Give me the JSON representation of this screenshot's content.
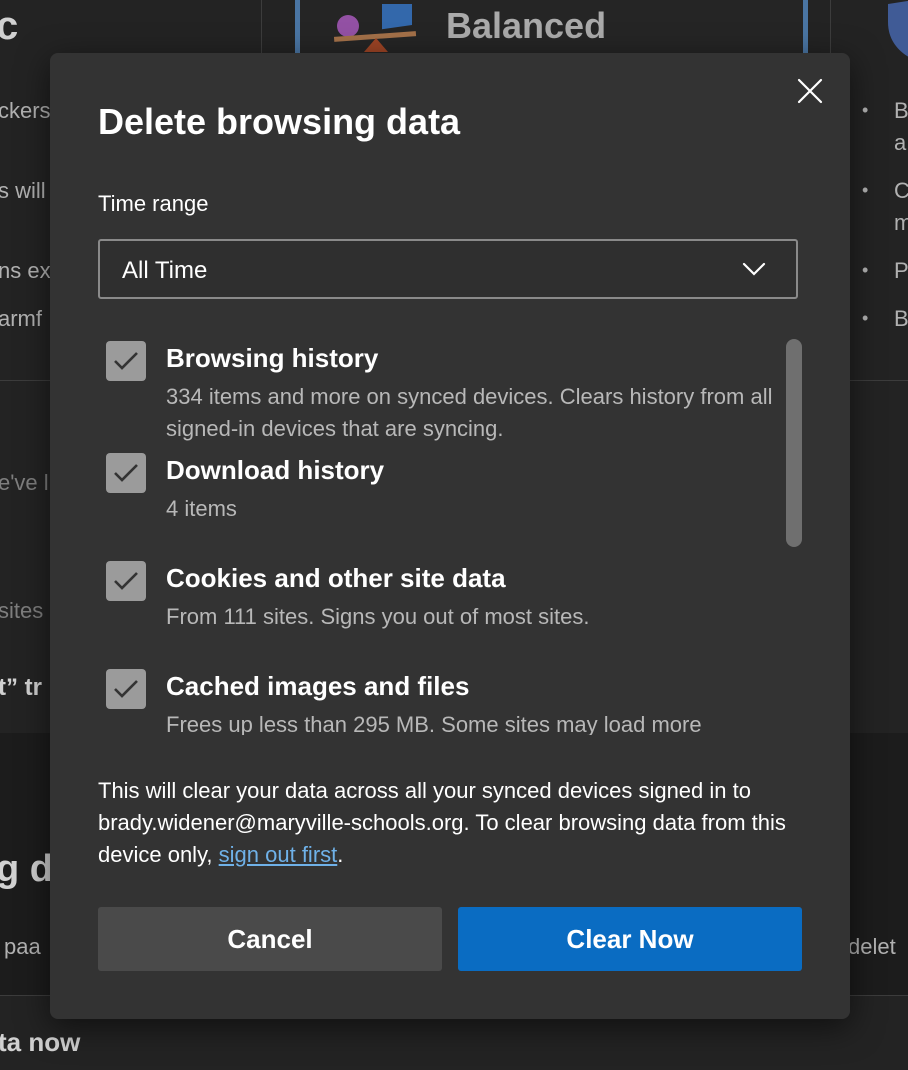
{
  "background": {
    "left_title_fragment": "c",
    "center_card_title": "Balanced",
    "left_text_fragments": [
      "ckers",
      "s will",
      "ns exp",
      "armf",
      "e've l",
      "sites",
      "t” tr"
    ],
    "right_bullets": [
      "B",
      "a",
      "C",
      "m",
      "P",
      "B"
    ],
    "section_heading_fragment": "g d",
    "bottom_left_fragment": "paa",
    "bottom_right_fragment": "delet",
    "footer_fragment": "ta now"
  },
  "dialog": {
    "title": "Delete browsing data",
    "close_icon": "close-icon",
    "time_range": {
      "label": "Time range",
      "selected": "All Time"
    },
    "items": [
      {
        "label": "Browsing history",
        "description": "334 items and more on synced devices. Clears history from all signed-in devices that are syncing.",
        "checked": true
      },
      {
        "label": "Download history",
        "description": "4 items",
        "checked": true
      },
      {
        "label": "Cookies and other site data",
        "description": "From 111 sites. Signs you out of most sites.",
        "checked": true
      },
      {
        "label": "Cached images and files",
        "description": "Frees up less than 295 MB. Some sites may load more",
        "checked": true
      }
    ],
    "notice": {
      "text": "This will clear your data across all your synced devices signed in to brady.widener@maryville-schools.org. To clear browsing data from this device only, ",
      "link": "sign out first",
      "suffix": "."
    },
    "buttons": {
      "cancel": "Cancel",
      "clear": "Clear Now"
    }
  },
  "colors": {
    "accent": "#0a6cc2",
    "link": "#6fb1e8",
    "dialog_bg": "#333333",
    "checkbox_bg": "#9b9b9b"
  }
}
